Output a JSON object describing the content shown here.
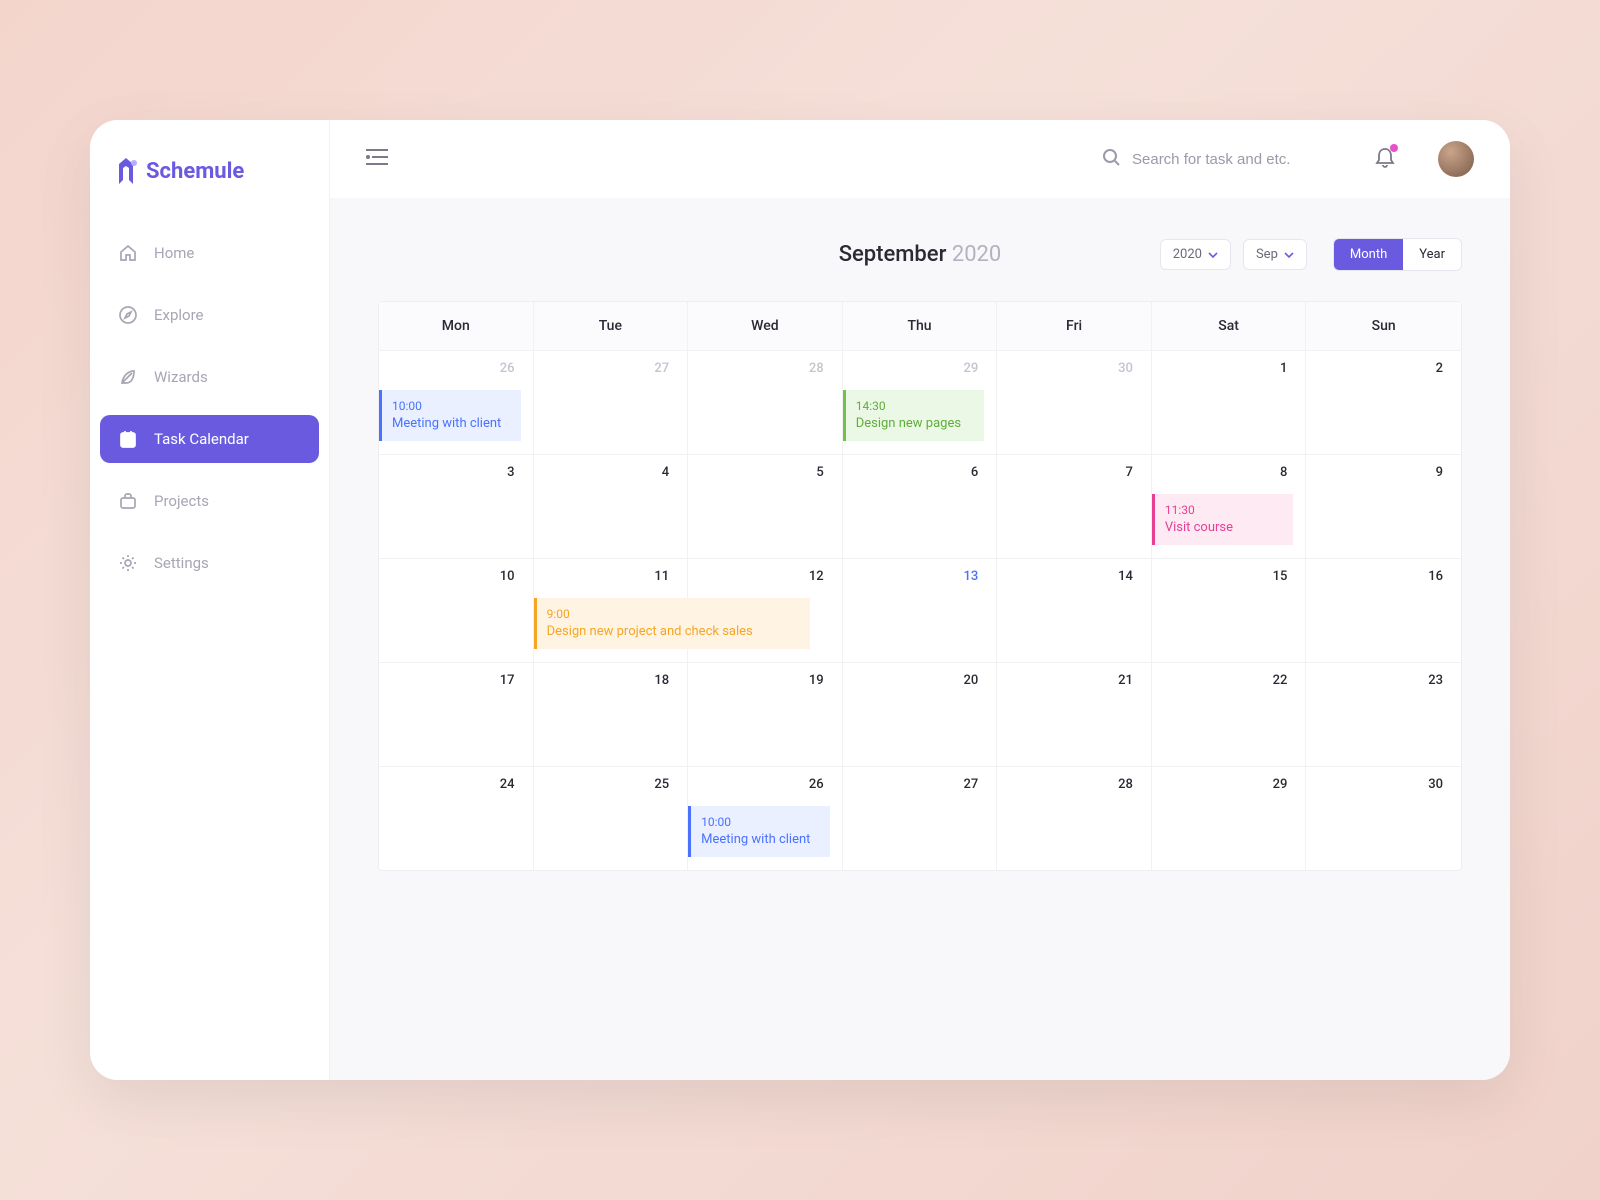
{
  "app": {
    "name": "Schemule"
  },
  "sidebar": {
    "items": [
      {
        "label": "Home",
        "icon": "home-icon"
      },
      {
        "label": "Explore",
        "icon": "compass-icon"
      },
      {
        "label": "Wizards",
        "icon": "feather-icon"
      },
      {
        "label": "Task Calendar",
        "icon": "calendar-icon"
      },
      {
        "label": "Projects",
        "icon": "briefcase-icon"
      },
      {
        "label": "Settings",
        "icon": "gear-icon"
      }
    ],
    "active_index": 3
  },
  "topbar": {
    "search_placeholder": "Search for task and etc."
  },
  "calendar": {
    "month": "September",
    "year": "2020",
    "year_select": "2020",
    "month_select": "Sep",
    "view_month_label": "Month",
    "view_year_label": "Year",
    "active_view": "month",
    "dow": [
      "Mon",
      "Tue",
      "Wed",
      "Thu",
      "Fri",
      "Sat",
      "Sun"
    ],
    "days": [
      {
        "n": "26",
        "muted": true,
        "events": [
          {
            "time": "10:00",
            "title": "Meeting with client",
            "style": "blue"
          }
        ]
      },
      {
        "n": "27",
        "muted": true
      },
      {
        "n": "28",
        "muted": true
      },
      {
        "n": "29",
        "muted": true,
        "events": [
          {
            "time": "14:30",
            "title": "Design new pages",
            "style": "green"
          }
        ]
      },
      {
        "n": "30",
        "muted": true
      },
      {
        "n": "1"
      },
      {
        "n": "2"
      },
      {
        "n": "3"
      },
      {
        "n": "4"
      },
      {
        "n": "5"
      },
      {
        "n": "6"
      },
      {
        "n": "7"
      },
      {
        "n": "8",
        "events": [
          {
            "time": "11:30",
            "title": "Visit course",
            "style": "pink"
          }
        ]
      },
      {
        "n": "9"
      },
      {
        "n": "10"
      },
      {
        "n": "11",
        "events": [
          {
            "time": "9:00",
            "title": "Design new project and check sales",
            "style": "orange",
            "span": 2
          }
        ]
      },
      {
        "n": "12"
      },
      {
        "n": "13",
        "highlight": true
      },
      {
        "n": "14"
      },
      {
        "n": "15"
      },
      {
        "n": "16"
      },
      {
        "n": "17"
      },
      {
        "n": "18"
      },
      {
        "n": "19"
      },
      {
        "n": "20"
      },
      {
        "n": "21"
      },
      {
        "n": "22"
      },
      {
        "n": "23"
      },
      {
        "n": "24"
      },
      {
        "n": "25"
      },
      {
        "n": "26",
        "events": [
          {
            "time": "10:00",
            "title": "Meeting with client",
            "style": "blue2"
          }
        ]
      },
      {
        "n": "27"
      },
      {
        "n": "28"
      },
      {
        "n": "29"
      },
      {
        "n": "30"
      }
    ]
  }
}
